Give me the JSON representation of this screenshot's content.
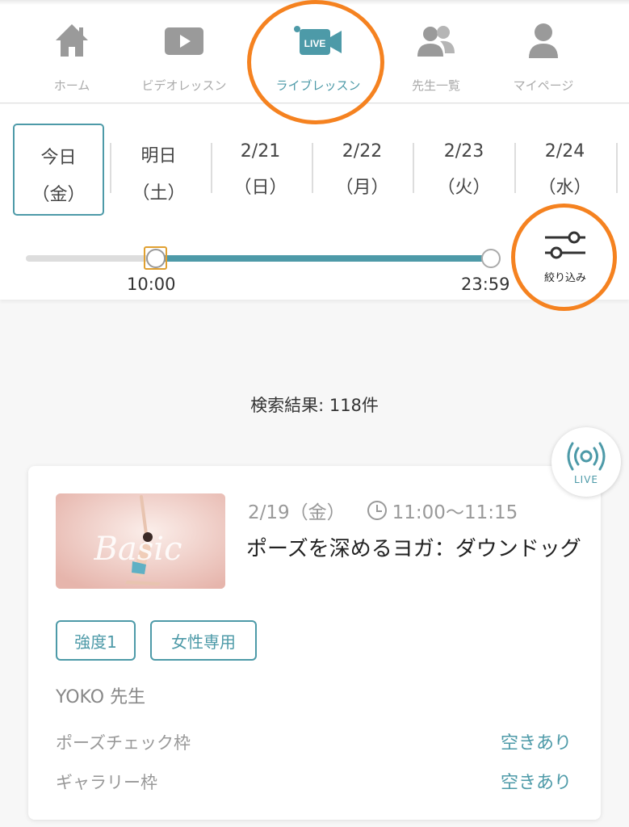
{
  "nav": {
    "items": [
      {
        "label": "ホーム",
        "icon": "home-icon"
      },
      {
        "label": "ビデオレッスン",
        "icon": "video-play-icon"
      },
      {
        "label": "ライブレッスン",
        "icon": "live-camera-icon",
        "badge": "LIVE",
        "active": true
      },
      {
        "label": "先生一覧",
        "icon": "people-icon"
      },
      {
        "label": "マイページ",
        "icon": "person-icon"
      }
    ]
  },
  "dates": [
    {
      "line1": "今日",
      "line2": "（金）",
      "selected": true
    },
    {
      "line1": "明日",
      "line2": "（土）"
    },
    {
      "line1": "2/21",
      "line2": "（日）"
    },
    {
      "line1": "2/22",
      "line2": "（月）"
    },
    {
      "line1": "2/23",
      "line2": "（火）"
    },
    {
      "line1": "2/24",
      "line2": "（水）"
    }
  ],
  "time_filter": {
    "start": "10:00",
    "end": "23:59"
  },
  "filter": {
    "label": "絞り込み",
    "icon": "sliders-icon"
  },
  "results": {
    "text": "検索結果: 118件"
  },
  "live_badge": {
    "label": "LIVE",
    "icon": "broadcast-icon"
  },
  "lesson": {
    "thumbnail_text": "Basic",
    "date": "2/19（金）",
    "time": "11:00〜11:15",
    "title": "ポーズを深めるヨガ：ダウンドッグ",
    "tags": [
      "強度1",
      "女性専用"
    ],
    "teacher": "YOKO 先生",
    "slots": [
      {
        "label": "ポーズチェック枠",
        "status": "空きあり"
      },
      {
        "label": "ギャラリー枠",
        "status": "空きあり"
      }
    ]
  },
  "colors": {
    "accent": "#4d9aa8",
    "highlight_ring": "#f58220",
    "selected_handle": "#e0a030"
  }
}
